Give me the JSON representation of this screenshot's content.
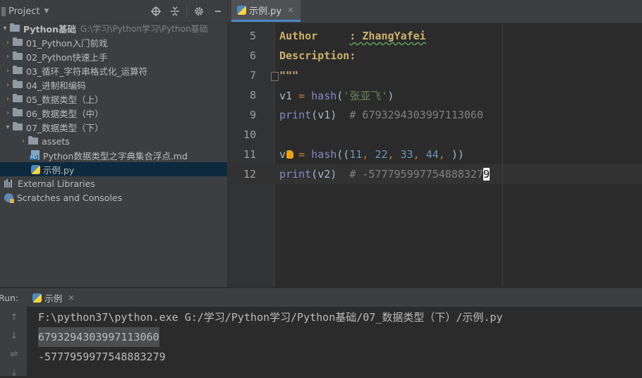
{
  "project_panel": {
    "title": "Project",
    "tree": [
      {
        "label": "Python基础",
        "path": "G:\\学习\\Python学习\\Python基础",
        "level": 0,
        "expanded": true
      },
      {
        "label": "01_Python入门前戏",
        "level": 1
      },
      {
        "label": "02_Python快速上手",
        "level": 1
      },
      {
        "label": "03_循环_字符串格式化_运算符",
        "level": 1
      },
      {
        "label": "04_进制和编码",
        "level": 1
      },
      {
        "label": "05_数据类型（上）",
        "level": 1
      },
      {
        "label": "06_数据类型（中）",
        "level": 1
      },
      {
        "label": "07_数据类型（下）",
        "level": 1,
        "expanded": true
      },
      {
        "label": "assets",
        "level": 2
      },
      {
        "label": "Python数据类型之字典集合浮点.md",
        "level": 2
      },
      {
        "label": "示例.py",
        "level": 2,
        "selected": true
      },
      {
        "label": "External Libraries",
        "level": 0
      },
      {
        "label": "Scratches and Consoles",
        "level": 0
      }
    ]
  },
  "editor": {
    "tab_label": "示例.py",
    "lines": [
      {
        "num": "5",
        "text_a": "Author",
        "text_b": ": ZhangYafei"
      },
      {
        "num": "6",
        "text": "Description:"
      },
      {
        "num": "7",
        "text": "\"\"\""
      },
      {
        "num": "8",
        "var": "v1",
        "op": "=",
        "fn": "hash",
        "str": "'张亚飞'"
      },
      {
        "num": "9",
        "fn": "print",
        "arg": "v1",
        "comment": "# 6793294303997113060"
      },
      {
        "num": "10"
      },
      {
        "num": "11",
        "var": "v2",
        "op": "=",
        "fn": "hash",
        "nums": [
          "11",
          "22",
          "33",
          "44"
        ]
      },
      {
        "num": "12",
        "fn": "print",
        "arg": "v2",
        "comment_main": "# -577795997754888327",
        "comment_caret": "9"
      }
    ]
  },
  "run_panel": {
    "label": "Run:",
    "tab_label": "示例",
    "output": [
      "F:\\python37\\python.exe G:/学习/Python学习/Python基础/07_数据类型（下）/示例.py",
      "6793294303997113060",
      "-5777959977548883279"
    ]
  }
}
